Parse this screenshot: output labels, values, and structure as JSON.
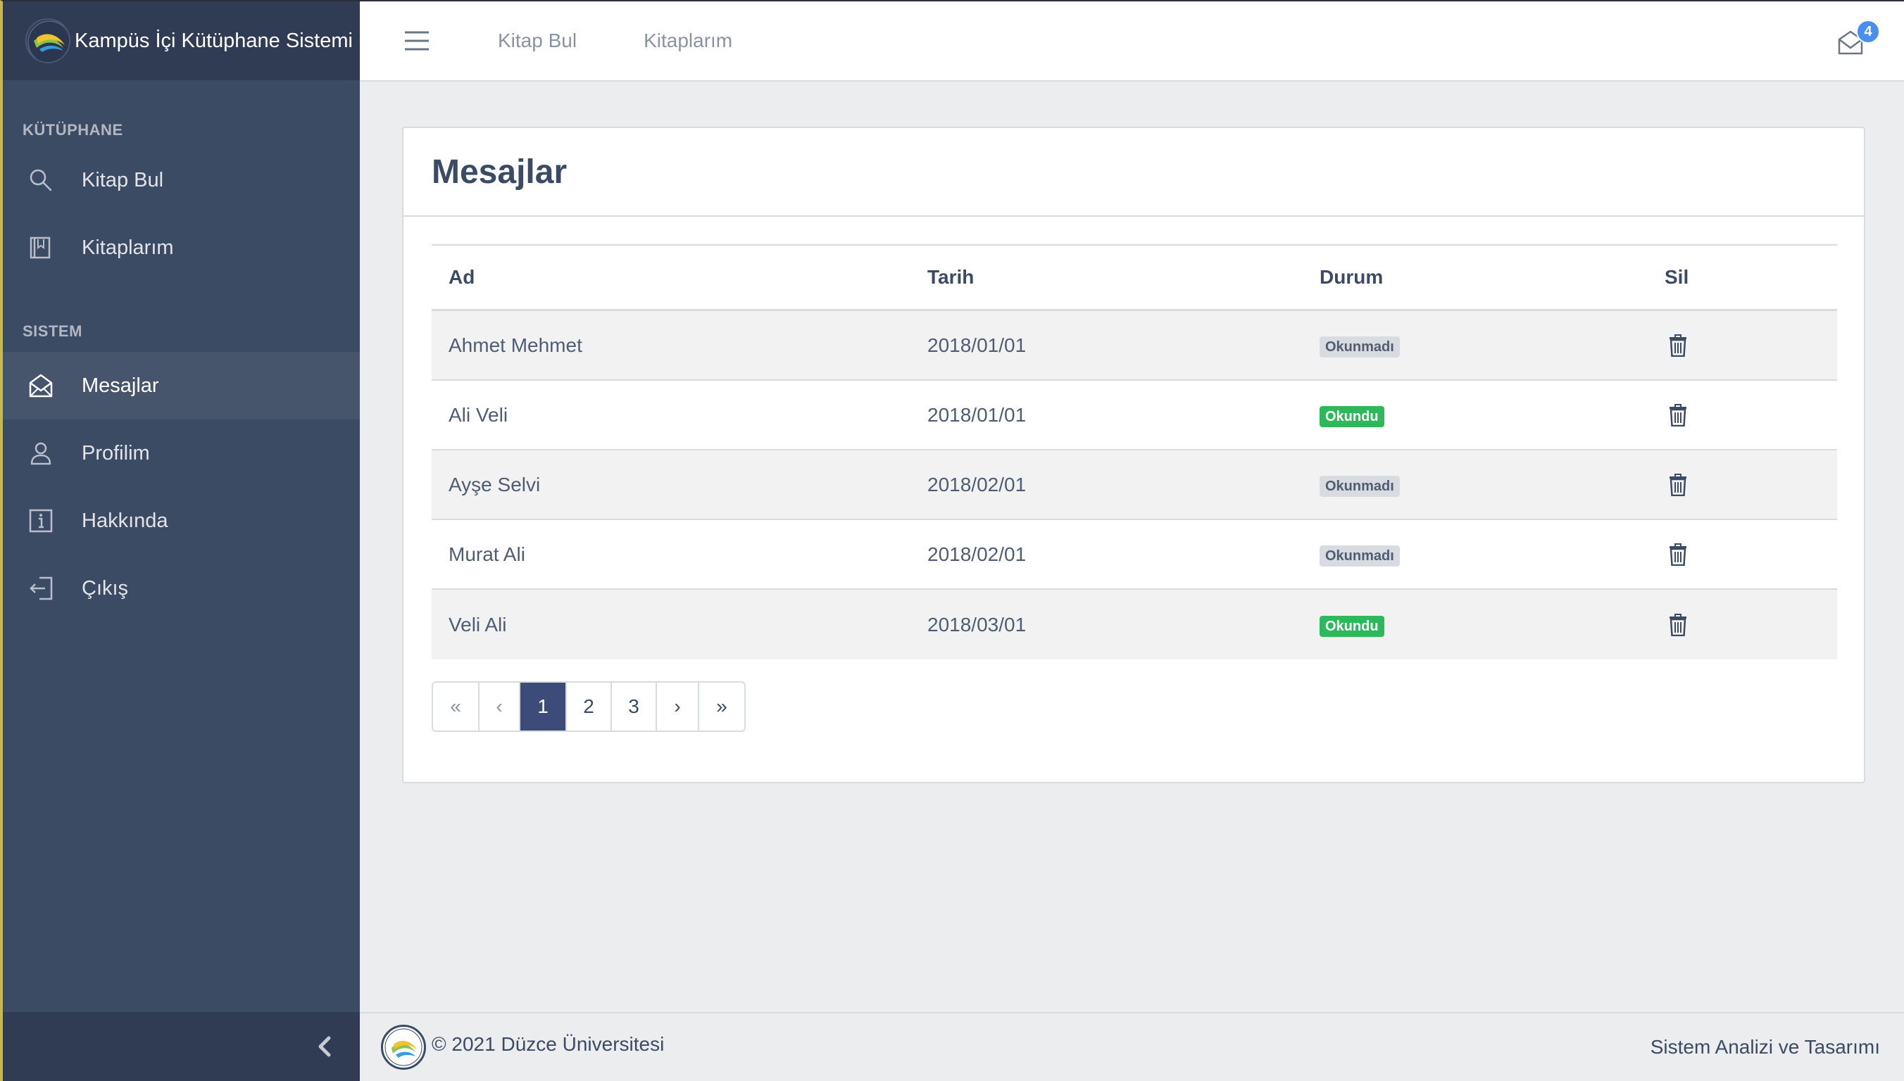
{
  "app": {
    "title": "Kampüs İçi Kütüphane Sistemi"
  },
  "sidebar": {
    "sections": [
      {
        "title": "KÜTÜPHANE"
      },
      {
        "title": "SISTEM"
      }
    ],
    "items": [
      {
        "label": "Kitap Bul",
        "icon": "search-icon"
      },
      {
        "label": "Kitaplarım",
        "icon": "book-icon"
      },
      {
        "label": "Mesajlar",
        "icon": "envelope-open-icon",
        "active": true
      },
      {
        "label": "Profilim",
        "icon": "user-icon"
      },
      {
        "label": "Hakkında",
        "icon": "info-icon"
      },
      {
        "label": "Çıkış",
        "icon": "logout-icon"
      }
    ]
  },
  "header": {
    "links": [
      "Kitap Bul",
      "Kitaplarım"
    ],
    "mail_badge": "4"
  },
  "card": {
    "title": "Mesajlar"
  },
  "table": {
    "columns": [
      "Ad",
      "Tarih",
      "Durum",
      "Sil"
    ],
    "rows": [
      {
        "ad": "Ahmet Mehmet",
        "tarih": "2018/01/01",
        "durum": "Okunmadı",
        "status": "unread"
      },
      {
        "ad": "Ali Veli",
        "tarih": "2018/01/01",
        "durum": "Okundu",
        "status": "read"
      },
      {
        "ad": "Ayşe Selvi",
        "tarih": "2018/02/01",
        "durum": "Okunmadı",
        "status": "unread"
      },
      {
        "ad": "Murat Ali",
        "tarih": "2018/02/01",
        "durum": "Okunmadı",
        "status": "unread"
      },
      {
        "ad": "Veli Ali",
        "tarih": "2018/03/01",
        "durum": "Okundu",
        "status": "read"
      }
    ]
  },
  "pagination": {
    "first": "«",
    "prev": "‹",
    "pages": [
      "1",
      "2",
      "3"
    ],
    "active_page": "1",
    "next": "›",
    "last": "»"
  },
  "footer": {
    "copyright": "© 2021 Düzce Üniversitesi",
    "right_text": "Sistem Analizi ve Tasarımı"
  },
  "colors": {
    "sidebar_bg": "#3c4b64",
    "brand_bg": "#303c54",
    "active_page": "#3c4b7a",
    "badge_read": "#2eb85c",
    "badge_unread": "#d8dbe0",
    "mail_badge": "#4a8ef0"
  }
}
